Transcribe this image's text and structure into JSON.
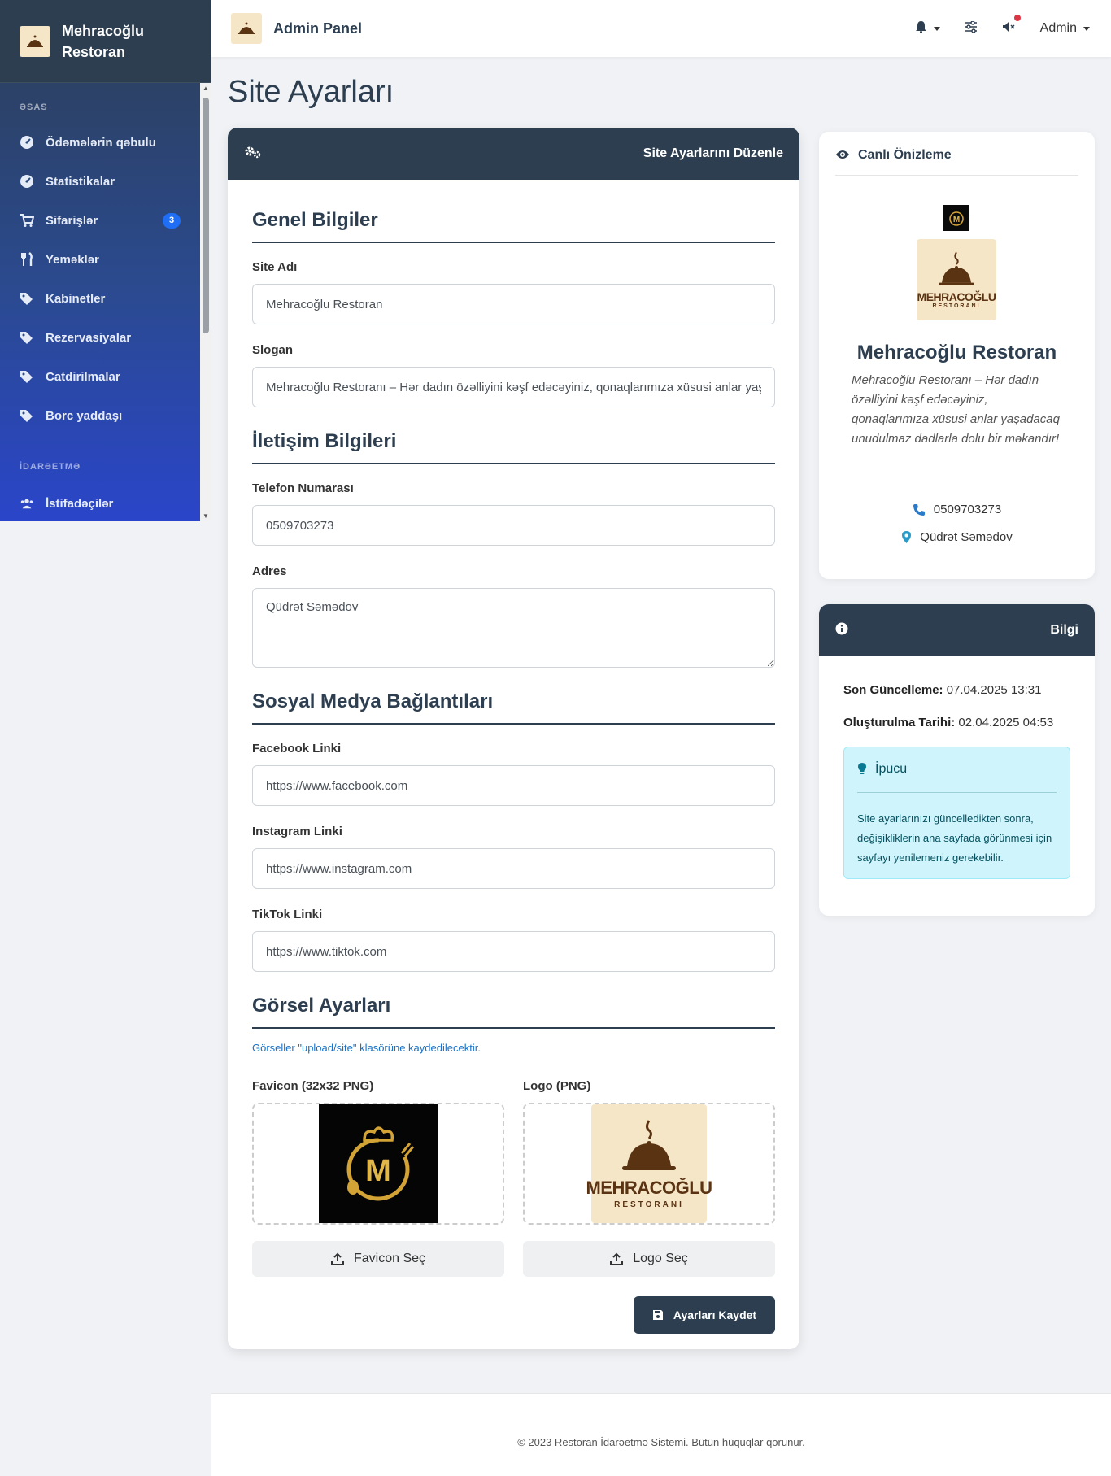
{
  "sidebar": {
    "brand": "Mehracoğlu Restoran",
    "sections": [
      "ƏSAS",
      "İDARƏETMƏ"
    ],
    "items": [
      {
        "label": "Ödəmələrin qəbulu",
        "icon": "dashboard-icon"
      },
      {
        "label": "Statistikalar",
        "icon": "dashboard-icon"
      },
      {
        "label": "Sifarişlər",
        "icon": "cart-icon",
        "badge": "3"
      },
      {
        "label": "Yeməklər",
        "icon": "utensils-icon"
      },
      {
        "label": "Kabinetler",
        "icon": "tags-icon"
      },
      {
        "label": "Rezervasiyalar",
        "icon": "tags-icon"
      },
      {
        "label": "Catdirilmalar",
        "icon": "tags-icon"
      },
      {
        "label": "Borc yaddaşı",
        "icon": "tags-icon"
      },
      {
        "label": "İstifadəçilər",
        "icon": "users-icon"
      }
    ]
  },
  "topbar": {
    "title": "Admin Panel",
    "user": "Admin",
    "icons": [
      "bell-icon",
      "sliders-icon",
      "mute-icon"
    ]
  },
  "page": {
    "title": "Site Ayarları"
  },
  "form": {
    "header": "Site Ayarlarını Düzenle",
    "sections": {
      "general": "Genel Bilgiler",
      "contact": "İletişim Bilgileri",
      "social": "Sosyal Medya Bağlantıları",
      "visual": "Görsel Ayarları"
    },
    "site_name": {
      "label": "Site Adı",
      "value": "Mehracoğlu Restoran"
    },
    "slogan": {
      "label": "Slogan",
      "value": "Mehracoğlu Restoranı – Hər dadın özəlliyini kəşf edəcəyiniz, qonaqlarımıza xüsusi anlar yaşadacaq unudulmaz dadlarla dolu bir məkandır!"
    },
    "phone": {
      "label": "Telefon Numarası",
      "value": "0509703273"
    },
    "address": {
      "label": "Adres",
      "value": "Qüdrət Səmədov"
    },
    "facebook": {
      "label": "Facebook Linki",
      "value": "https://www.facebook.com"
    },
    "instagram": {
      "label": "Instagram Linki",
      "value": "https://www.instagram.com"
    },
    "tiktok": {
      "label": "TikTok Linki",
      "value": "https://www.tiktok.com"
    },
    "visual_note": "Görseller \"upload/site\" klasörüne kaydedilecektir.",
    "favicon_label": "Favicon (32x32 PNG)",
    "logo_label": "Logo (PNG)",
    "favicon_button": "Favicon Seç",
    "logo_button": "Logo Seç",
    "save_button": "Ayarları Kaydet",
    "logo_letter": "M",
    "logo_text": "MEHRACOĞLU",
    "logo_sub": "RESTORANI"
  },
  "preview": {
    "title": "Canlı Önizleme",
    "name": "Mehracoğlu Restoran",
    "slogan": "Mehracoğlu Restoranı – Hər dadın özəlliyini kəşf edəcəyiniz, qonaqlarımıza xüsusi anlar yaşadacaq unudulmaz dadlarla dolu bir məkandır!",
    "phone": "0509703273",
    "address": "Qüdrət Səmədov"
  },
  "info": {
    "title": "Bilgi",
    "last_update_label": "Son Güncelleme:",
    "last_update": "07.04.2025 13:31",
    "created_label": "Oluşturulma Tarihi:",
    "created": "02.04.2025 04:53",
    "tip_title": "İpucu",
    "tip_text": "Site ayarlarınızı güncelledikten sonra, değişikliklerin ana sayfada görünmesi için sayfayı yenilemeniz gerekebilir."
  },
  "footer": "© 2023 Restoran İdarəetmə Sistemi. Bütün hüquqlar qorunur.",
  "colors": {
    "primary": "#2c3e50",
    "accent": "#1e6ff5",
    "tip_bg": "#cff4fc",
    "logo_bg": "#f6e6c8"
  }
}
